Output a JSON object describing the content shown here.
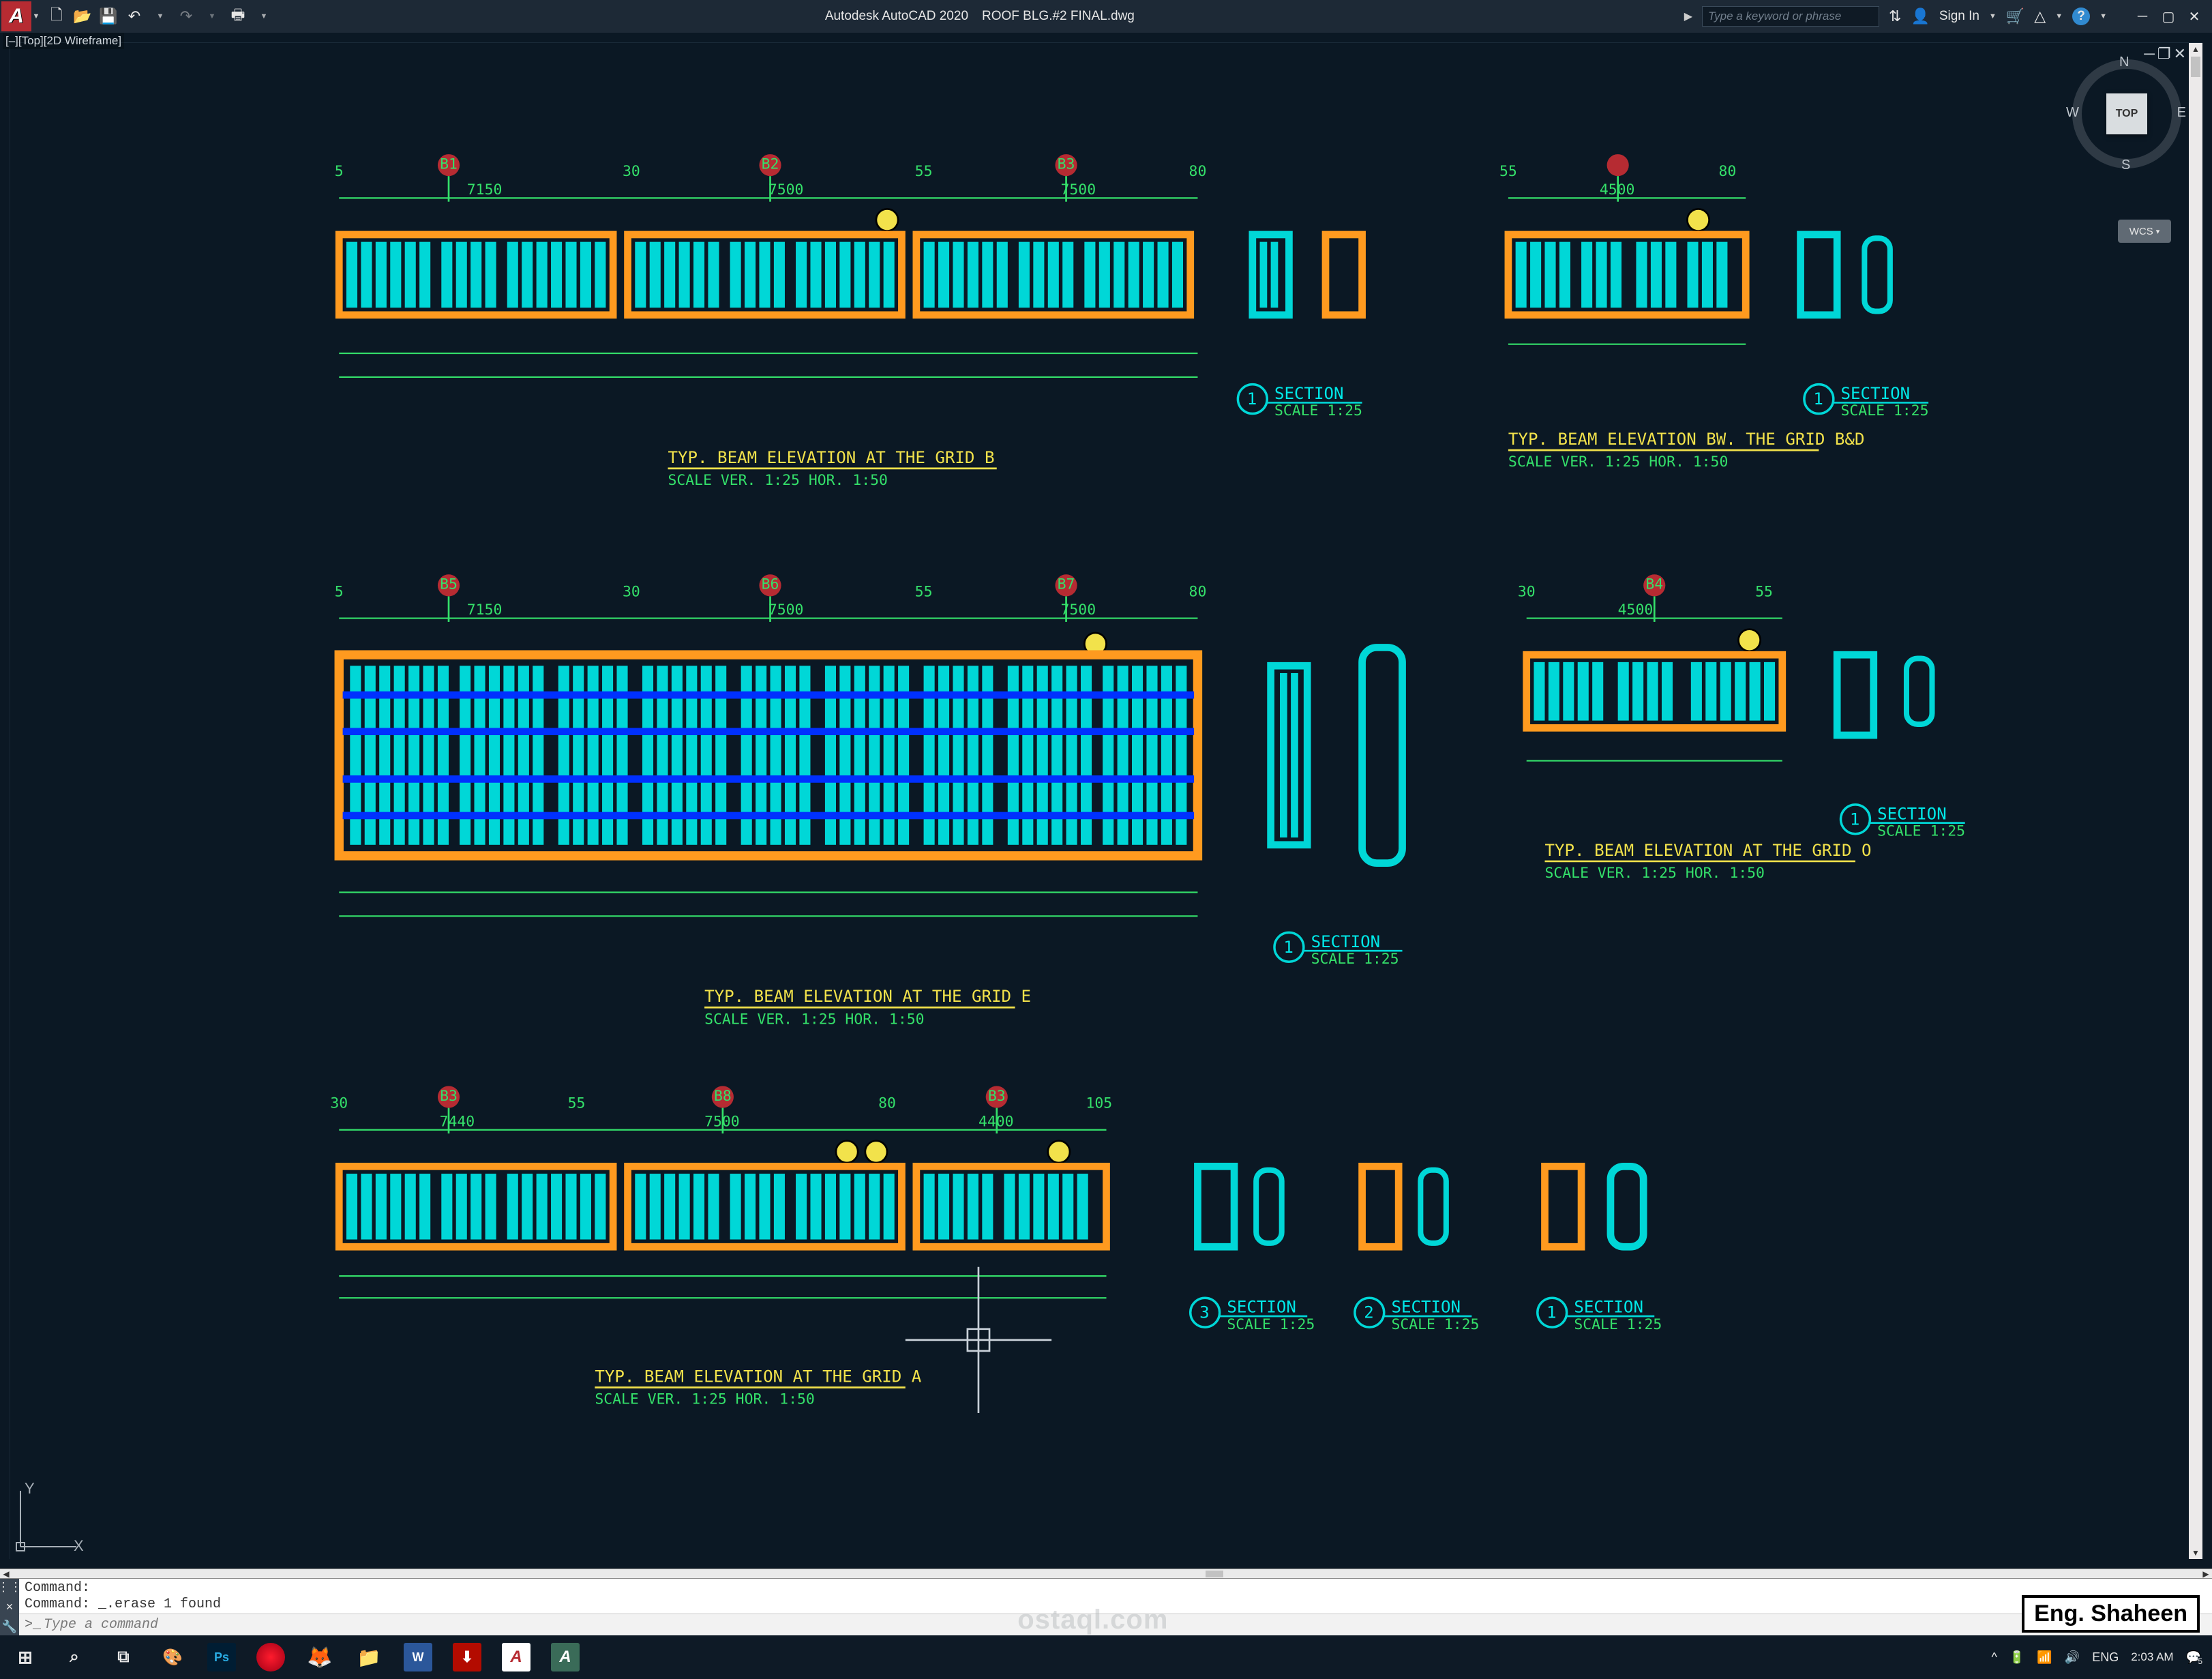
{
  "titlebar": {
    "app_logo_letter": "A",
    "app_name": "Autodesk AutoCAD 2020",
    "file_name": "ROOF BLG.#2 FINAL.dwg",
    "search_placeholder": "Type a keyword or phrase",
    "sign_in": "Sign In"
  },
  "viewport_control": "[–][Top][2D Wireframe]",
  "viewcube": {
    "face": "TOP",
    "north": "N",
    "south": "S",
    "east": "E",
    "west": "W",
    "wcs_label": "WCS"
  },
  "ucs": {
    "x_label": "X",
    "y_label": "Y"
  },
  "drawings": {
    "row1_left": {
      "title": "TYP. BEAM ELEVATION AT THE GRID B",
      "scale": "SCALE VER. 1:25 HOR. 1:50",
      "section_label": "SECTION",
      "section_scale": "SCALE     1:25",
      "section_num": "1",
      "grid_marks": [
        "B1",
        "B2",
        "B3"
      ],
      "axis_nums": [
        "5",
        "30",
        "55",
        "80"
      ],
      "axis_dims": [
        "7150",
        "7500",
        "7500"
      ]
    },
    "row1_right": {
      "title": "TYP. BEAM ELEVATION BW. THE GRID B&D",
      "scale": "SCALE VER. 1:25 HOR. 1:50",
      "section_label": "SECTION",
      "section_scale": "SCALE     1:25",
      "section_num": "1",
      "axis_nums": [
        "55",
        "80"
      ],
      "axis_dims": [
        "4500"
      ]
    },
    "row2_left": {
      "title": "TYP. BEAM ELEVATION AT THE GRID E",
      "scale": "SCALE VER. 1:25 HOR. 1:50",
      "section_label": "SECTION",
      "section_scale": "SCALE     1:25",
      "section_num": "1",
      "grid_marks": [
        "B5",
        "B6",
        "B7"
      ],
      "axis_nums": [
        "5",
        "30",
        "55",
        "80"
      ],
      "axis_dims": [
        "7150",
        "7500",
        "7500"
      ]
    },
    "row2_right": {
      "title": "TYP. BEAM ELEVATION AT THE GRID O",
      "scale": "SCALE VER. 1:25 HOR. 1:50",
      "section_label": "SECTION",
      "section_scale": "SCALE     1:25",
      "section_num": "1",
      "grid_marks": [
        "B4"
      ],
      "axis_nums": [
        "30",
        "55"
      ],
      "axis_dims": [
        "4500"
      ]
    },
    "row3": {
      "title": "TYP. BEAM ELEVATION AT THE GRID A",
      "scale": "SCALE VER. 1:25 HOR. 1:50",
      "grid_marks": [
        "B3",
        "B8",
        "B3"
      ],
      "axis_nums": [
        "30",
        "55",
        "80",
        "105"
      ],
      "axis_dims": [
        "7440",
        "7500",
        "4400"
      ],
      "sections": [
        {
          "num": "3",
          "label": "SECTION",
          "scale": "SCALE     1:25"
        },
        {
          "num": "2",
          "label": "SECTION",
          "scale": "SCALE     1:25"
        },
        {
          "num": "1",
          "label": "SECTION",
          "scale": "SCALE     1:25"
        }
      ]
    }
  },
  "command": {
    "hist1": "Command:",
    "hist2": "Command: _.erase 1 found",
    "prompt": ">_",
    "placeholder": "Type a command"
  },
  "watermark": "Eng. Shaheen",
  "faded_brand": "ostaql.com",
  "taskbar": {
    "lang": "ENG",
    "time": "2:03 AM",
    "date": "",
    "notif_count": "5"
  }
}
